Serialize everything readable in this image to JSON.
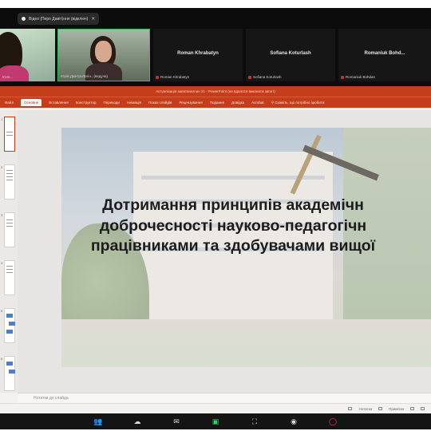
{
  "meeting": {
    "status_pill": "Вiдео (Перо Давiт)ння (вiдключ)",
    "participants": [
      {
        "name": "",
        "caption": "Юля...",
        "muted": false
      },
      {
        "name": "",
        "caption": "Юрій Дмитро/Блін...(ведуча)",
        "muted": false
      },
      {
        "name": "Roman Khrabatyn",
        "caption": "Roman Khrabatyn",
        "muted": true
      },
      {
        "name": "Sofiana Koturlash",
        "caption": "Sofiana Koturlash",
        "muted": true
      },
      {
        "name": "Romaniuk Bohd...",
        "caption": "Romaniuk Bohdan",
        "muted": true
      }
    ]
  },
  "powerpoint": {
    "window_title": "Актуалізація запитання мн 21 - PowerPoint (не вдалося виконати запит)",
    "ribbon_tabs": [
      "Файл",
      "Основне",
      "Вставлення",
      "Конструктор",
      "Переходи",
      "Анімація",
      "Показ слайдів",
      "Рецензування",
      "Подання",
      "Довідка",
      "Acrobat"
    ],
    "active_tab": "Основне",
    "search_hint": "Скажіть, що потрібно зробити",
    "thumbnail_numbers": [
      "1",
      "2",
      "3",
      "4",
      "5",
      "6"
    ],
    "slide_title": "Дотримання принципів академічн\nдоброчесності науково-педагогічн\nпрацівниками та здобувачами вищої",
    "notes_placeholder": "Нотатки до слайда",
    "status_items": [
      "Нотатки",
      "Примітки"
    ]
  },
  "toolbar": {
    "items": [
      {
        "icon": "participants-icon"
      },
      {
        "icon": "reactions-icon"
      },
      {
        "icon": "chat-icon"
      },
      {
        "icon": "share-icon"
      },
      {
        "icon": "fullscreen-icon"
      },
      {
        "icon": "record-icon"
      },
      {
        "icon": "leave-icon"
      }
    ]
  },
  "colors": {
    "ppt_accent": "#c43e1c",
    "active_speaker": "#2fbf5d",
    "muted": "#c9302c"
  }
}
